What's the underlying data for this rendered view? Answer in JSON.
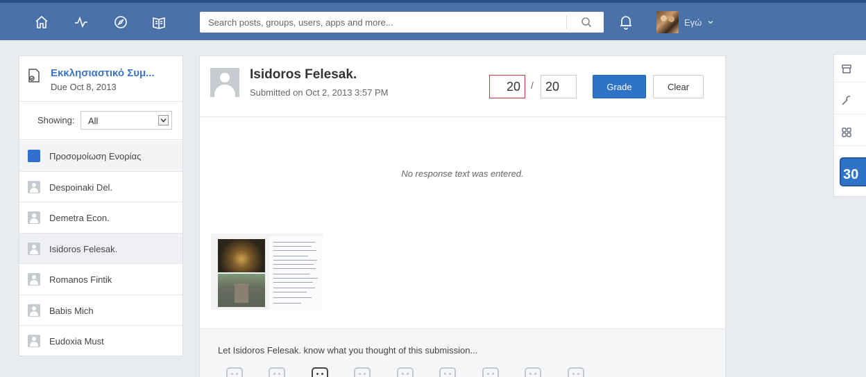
{
  "topbar": {
    "search": {
      "placeholder": "Search posts, groups, users, apps and more..."
    },
    "user": {
      "label": "Εγώ"
    },
    "nav_icons": [
      "home-icon",
      "activity-icon",
      "compass-icon",
      "backpack-icon"
    ],
    "colors": {
      "bar": "#4a71a8",
      "bar_border": "#2a4f86"
    }
  },
  "assignment": {
    "title": "Εκκλησιαστικό Συμ...",
    "due": "Due Oct 8, 2013"
  },
  "filter": {
    "label": "Showing:",
    "value": "All"
  },
  "students": [
    {
      "name": "Προσομοίωση Ενορίας",
      "type": "group"
    },
    {
      "name": "Despoinaki Del.",
      "type": "student"
    },
    {
      "name": "Demetra Econ.",
      "type": "student"
    },
    {
      "name": "Isidoros Felesak.",
      "type": "student",
      "selected": true
    },
    {
      "name": "Romanos Fintik",
      "type": "student"
    },
    {
      "name": "Babis Mich",
      "type": "student"
    },
    {
      "name": "Eudoxia Must",
      "type": "student"
    }
  ],
  "submission": {
    "student_name": "Isidoros Felesak.",
    "submitted": "Submitted on Oct 2, 2013 3:57 PM",
    "score_earned": "20",
    "score_separator": "/",
    "score_total": "20",
    "grade_label": "Grade",
    "clear_label": "Clear",
    "no_response": "No response text was entered.",
    "feedback_prompt": "Let Isidoros Felesak. know what you thought of this submission..."
  },
  "right_rail": {
    "icons": [
      "backpack-icon",
      "wrench-icon",
      "apps-grid-icon"
    ],
    "calendar_day": "30"
  },
  "accent": "#2f73c7"
}
